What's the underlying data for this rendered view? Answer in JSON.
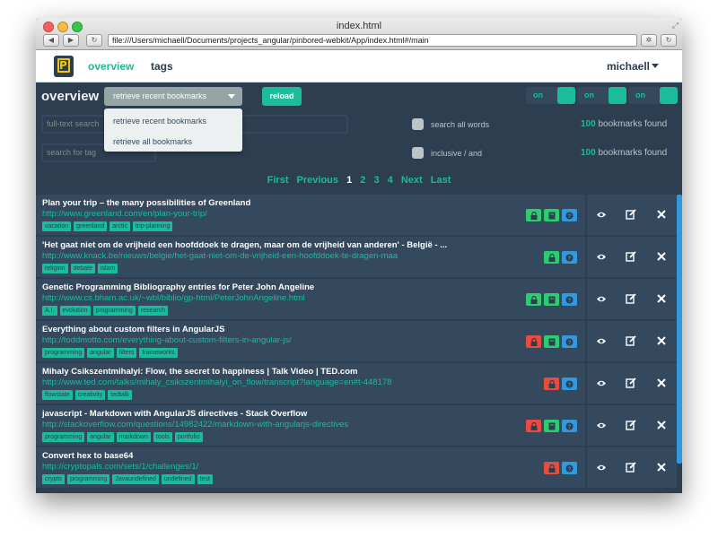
{
  "window": {
    "title": "index.html",
    "url": "file:///Users/michaell/Documents/projects_angular/pinbored-webkit/App/index.html#/main"
  },
  "header": {
    "logo_letter": "P",
    "nav": [
      {
        "label": "overview",
        "active": true
      },
      {
        "label": "tags",
        "active": false
      }
    ],
    "user": "michaell"
  },
  "toolbar": {
    "page_title": "overview",
    "select_value": "retrieve recent bookmarks",
    "reload_label": "reload",
    "toggles": [
      "on",
      "on",
      "on"
    ]
  },
  "dropdown": {
    "options": [
      "retrieve recent bookmarks",
      "retrieve all bookmarks"
    ]
  },
  "search": {
    "fulltext_placeholder": "full-text search",
    "tag_placeholder": "search for tag",
    "search_all_words_label": "search all words",
    "inclusive_label": "inclusive / and",
    "found_count_1": "100",
    "found_count_2": "100",
    "found_suffix": "bookmarks found"
  },
  "pagination": {
    "first": "First",
    "previous": "Previous",
    "pages": [
      "1",
      "2",
      "3",
      "4"
    ],
    "current": "1",
    "next": "Next",
    "last": "Last"
  },
  "bookmarks": [
    {
      "title": "Plan your trip – the many possibilities of Greenland",
      "url": "http://www.greenland.com/en/plan-your-trip/",
      "tags": [
        "vacation",
        "greenland",
        "arctic",
        "trip-planning"
      ],
      "status": [
        "lock-green",
        "note-green",
        "info-blue"
      ]
    },
    {
      "title": "'Het gaat niet om de vrijheid een hoofddoek te dragen, maar om de vrijheid van anderen' - België - ...",
      "url": "http://www.knack.be/nieuws/belgie/het-gaat-niet-om-de-vrijheid-een-hoofddoek-te-dragen-maa",
      "tags": [
        "religion",
        "debate",
        "islam"
      ],
      "status": [
        "lock-green",
        "info-blue"
      ]
    },
    {
      "title": "Genetic Programming Bibliography entries for Peter John Angeline",
      "url": "http://www.cs.bham.ac.uk/~wbl/biblio/gp-html/PeterJohnAngeline.html",
      "tags": [
        "A.I.",
        "evolution",
        "programming",
        "research"
      ],
      "status": [
        "lock-green",
        "note-green",
        "info-blue"
      ]
    },
    {
      "title": "Everything about custom filters in AngularJS",
      "url": "http://toddmotto.com/everything-about-custom-filters-in-angular-js/",
      "tags": [
        "programming",
        "angular",
        "filters",
        "frameworks"
      ],
      "status": [
        "lock-red",
        "note-green",
        "info-blue"
      ]
    },
    {
      "title": "Mihaly Csikszentmihalyi: Flow, the secret to happiness | Talk Video | TED.com",
      "url": "http://www.ted.com/talks/mihaly_csikszentmihalyi_on_flow/transcript?language=en#t-448178",
      "tags": [
        "flowstate",
        "creativity",
        "tedtalk"
      ],
      "status": [
        "lock-red",
        "info-blue"
      ]
    },
    {
      "title": "javascript - Markdown with AngularJS directives - Stack Overflow",
      "url": "http://stackoverflow.com/questions/14982422/markdown-with-angularjs-directives",
      "tags": [
        "programming",
        "angular",
        "markdown",
        "tools",
        "portfolio"
      ],
      "status": [
        "lock-red",
        "note-green",
        "info-blue"
      ]
    },
    {
      "title": "Convert hex to base64",
      "url": "http://cryptopals.com/sets/1/challenges/1/",
      "tags": [
        "crypto",
        "programming",
        "Javaundefined",
        "undefined",
        "test"
      ],
      "status": [
        "lock-red",
        "info-blue"
      ]
    }
  ],
  "colors": {
    "background": "#2c3e50",
    "row": "#34495e",
    "accent": "#1abc9c",
    "red": "#e74c3c",
    "green": "#2ecc71",
    "blue": "#3498db"
  },
  "icons": {
    "view": "eye-icon",
    "edit": "edit-icon",
    "delete": "close-icon",
    "lock": "lock-icon",
    "note": "note-icon",
    "info": "info-icon"
  }
}
